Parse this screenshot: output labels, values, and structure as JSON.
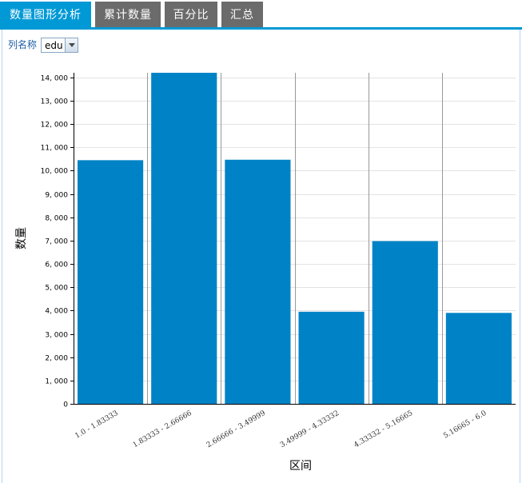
{
  "tabs": [
    {
      "label": "数量图形分析",
      "active": true
    },
    {
      "label": "累计数量",
      "active": false
    },
    {
      "label": "百分比",
      "active": false
    },
    {
      "label": "汇总",
      "active": false
    }
  ],
  "controls": {
    "column_label": "列名称",
    "column_value": "edu"
  },
  "colors": {
    "accent": "#0099d6",
    "bar": "#0083c6",
    "tab_inactive": "#6b6b6b"
  },
  "chart_data": {
    "type": "bar",
    "categories": [
      "1.0 - 1.83333",
      "1.83333 - 2.66666",
      "2.66666 - 3.49999",
      "3.49999 - 4.33332",
      "4.33332 - 5.16665",
      "5.16665 - 6.0"
    ],
    "values": [
      10450,
      14200,
      10470,
      3950,
      6980,
      3900
    ],
    "xlabel": "区间",
    "ylabel": "数量",
    "ylim": [
      0,
      14200
    ],
    "yticks": [
      0,
      1000,
      2000,
      3000,
      4000,
      5000,
      6000,
      7000,
      8000,
      9000,
      10000,
      11000,
      12000,
      13000,
      14000
    ],
    "ytick_labels": [
      "0",
      "1, 000",
      "2, 000",
      "3, 000",
      "4, 000",
      "5, 000",
      "6, 000",
      "7, 000",
      "8, 000",
      "9, 000",
      "10, 000",
      "11, 000",
      "12, 000",
      "13, 000",
      "14, 000"
    ],
    "grid": true
  }
}
